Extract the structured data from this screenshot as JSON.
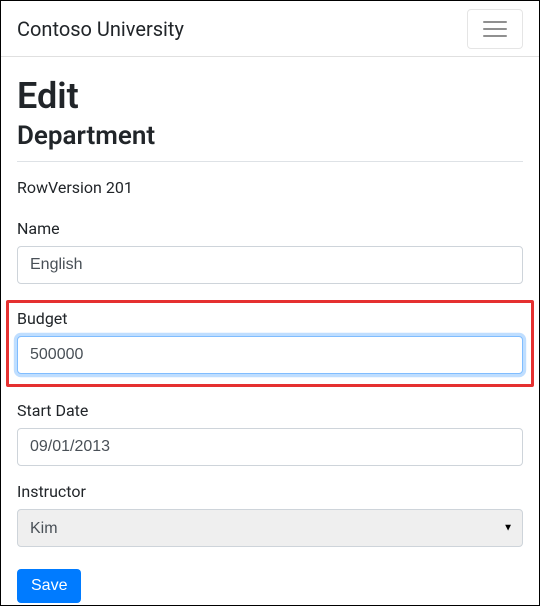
{
  "navbar": {
    "brand": "Contoso University"
  },
  "page": {
    "title": "Edit",
    "subtitle": "Department"
  },
  "rowversion": {
    "label": "RowVersion",
    "value": "201"
  },
  "form": {
    "name": {
      "label": "Name",
      "value": "English"
    },
    "budget": {
      "label": "Budget",
      "value": "500000"
    },
    "start_date": {
      "label": "Start Date",
      "value": "09/01/2013"
    },
    "instructor": {
      "label": "Instructor",
      "selected": "Kim"
    },
    "save_label": "Save"
  }
}
